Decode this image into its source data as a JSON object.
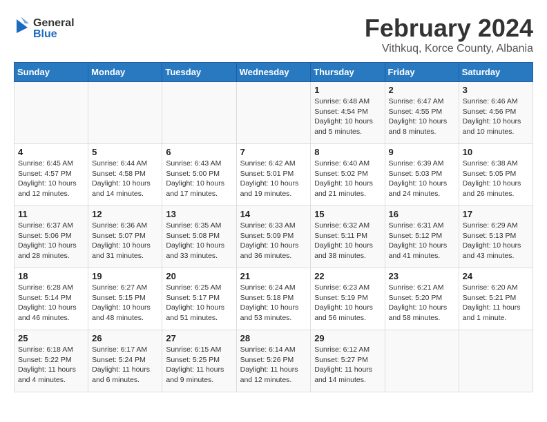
{
  "header": {
    "logo": {
      "general": "General",
      "blue": "Blue"
    },
    "title": "February 2024",
    "subtitle": "Vithkuq, Korce County, Albania"
  },
  "days_of_week": [
    "Sunday",
    "Monday",
    "Tuesday",
    "Wednesday",
    "Thursday",
    "Friday",
    "Saturday"
  ],
  "weeks": [
    [
      {
        "day": "",
        "info": ""
      },
      {
        "day": "",
        "info": ""
      },
      {
        "day": "",
        "info": ""
      },
      {
        "day": "",
        "info": ""
      },
      {
        "day": "1",
        "info": "Sunrise: 6:48 AM\nSunset: 4:54 PM\nDaylight: 10 hours and 5 minutes."
      },
      {
        "day": "2",
        "info": "Sunrise: 6:47 AM\nSunset: 4:55 PM\nDaylight: 10 hours and 8 minutes."
      },
      {
        "day": "3",
        "info": "Sunrise: 6:46 AM\nSunset: 4:56 PM\nDaylight: 10 hours and 10 minutes."
      }
    ],
    [
      {
        "day": "4",
        "info": "Sunrise: 6:45 AM\nSunset: 4:57 PM\nDaylight: 10 hours and 12 minutes."
      },
      {
        "day": "5",
        "info": "Sunrise: 6:44 AM\nSunset: 4:58 PM\nDaylight: 10 hours and 14 minutes."
      },
      {
        "day": "6",
        "info": "Sunrise: 6:43 AM\nSunset: 5:00 PM\nDaylight: 10 hours and 17 minutes."
      },
      {
        "day": "7",
        "info": "Sunrise: 6:42 AM\nSunset: 5:01 PM\nDaylight: 10 hours and 19 minutes."
      },
      {
        "day": "8",
        "info": "Sunrise: 6:40 AM\nSunset: 5:02 PM\nDaylight: 10 hours and 21 minutes."
      },
      {
        "day": "9",
        "info": "Sunrise: 6:39 AM\nSunset: 5:03 PM\nDaylight: 10 hours and 24 minutes."
      },
      {
        "day": "10",
        "info": "Sunrise: 6:38 AM\nSunset: 5:05 PM\nDaylight: 10 hours and 26 minutes."
      }
    ],
    [
      {
        "day": "11",
        "info": "Sunrise: 6:37 AM\nSunset: 5:06 PM\nDaylight: 10 hours and 28 minutes."
      },
      {
        "day": "12",
        "info": "Sunrise: 6:36 AM\nSunset: 5:07 PM\nDaylight: 10 hours and 31 minutes."
      },
      {
        "day": "13",
        "info": "Sunrise: 6:35 AM\nSunset: 5:08 PM\nDaylight: 10 hours and 33 minutes."
      },
      {
        "day": "14",
        "info": "Sunrise: 6:33 AM\nSunset: 5:09 PM\nDaylight: 10 hours and 36 minutes."
      },
      {
        "day": "15",
        "info": "Sunrise: 6:32 AM\nSunset: 5:11 PM\nDaylight: 10 hours and 38 minutes."
      },
      {
        "day": "16",
        "info": "Sunrise: 6:31 AM\nSunset: 5:12 PM\nDaylight: 10 hours and 41 minutes."
      },
      {
        "day": "17",
        "info": "Sunrise: 6:29 AM\nSunset: 5:13 PM\nDaylight: 10 hours and 43 minutes."
      }
    ],
    [
      {
        "day": "18",
        "info": "Sunrise: 6:28 AM\nSunset: 5:14 PM\nDaylight: 10 hours and 46 minutes."
      },
      {
        "day": "19",
        "info": "Sunrise: 6:27 AM\nSunset: 5:15 PM\nDaylight: 10 hours and 48 minutes."
      },
      {
        "day": "20",
        "info": "Sunrise: 6:25 AM\nSunset: 5:17 PM\nDaylight: 10 hours and 51 minutes."
      },
      {
        "day": "21",
        "info": "Sunrise: 6:24 AM\nSunset: 5:18 PM\nDaylight: 10 hours and 53 minutes."
      },
      {
        "day": "22",
        "info": "Sunrise: 6:23 AM\nSunset: 5:19 PM\nDaylight: 10 hours and 56 minutes."
      },
      {
        "day": "23",
        "info": "Sunrise: 6:21 AM\nSunset: 5:20 PM\nDaylight: 10 hours and 58 minutes."
      },
      {
        "day": "24",
        "info": "Sunrise: 6:20 AM\nSunset: 5:21 PM\nDaylight: 11 hours and 1 minute."
      }
    ],
    [
      {
        "day": "25",
        "info": "Sunrise: 6:18 AM\nSunset: 5:22 PM\nDaylight: 11 hours and 4 minutes."
      },
      {
        "day": "26",
        "info": "Sunrise: 6:17 AM\nSunset: 5:24 PM\nDaylight: 11 hours and 6 minutes."
      },
      {
        "day": "27",
        "info": "Sunrise: 6:15 AM\nSunset: 5:25 PM\nDaylight: 11 hours and 9 minutes."
      },
      {
        "day": "28",
        "info": "Sunrise: 6:14 AM\nSunset: 5:26 PM\nDaylight: 11 hours and 12 minutes."
      },
      {
        "day": "29",
        "info": "Sunrise: 6:12 AM\nSunset: 5:27 PM\nDaylight: 11 hours and 14 minutes."
      },
      {
        "day": "",
        "info": ""
      },
      {
        "day": "",
        "info": ""
      }
    ]
  ]
}
